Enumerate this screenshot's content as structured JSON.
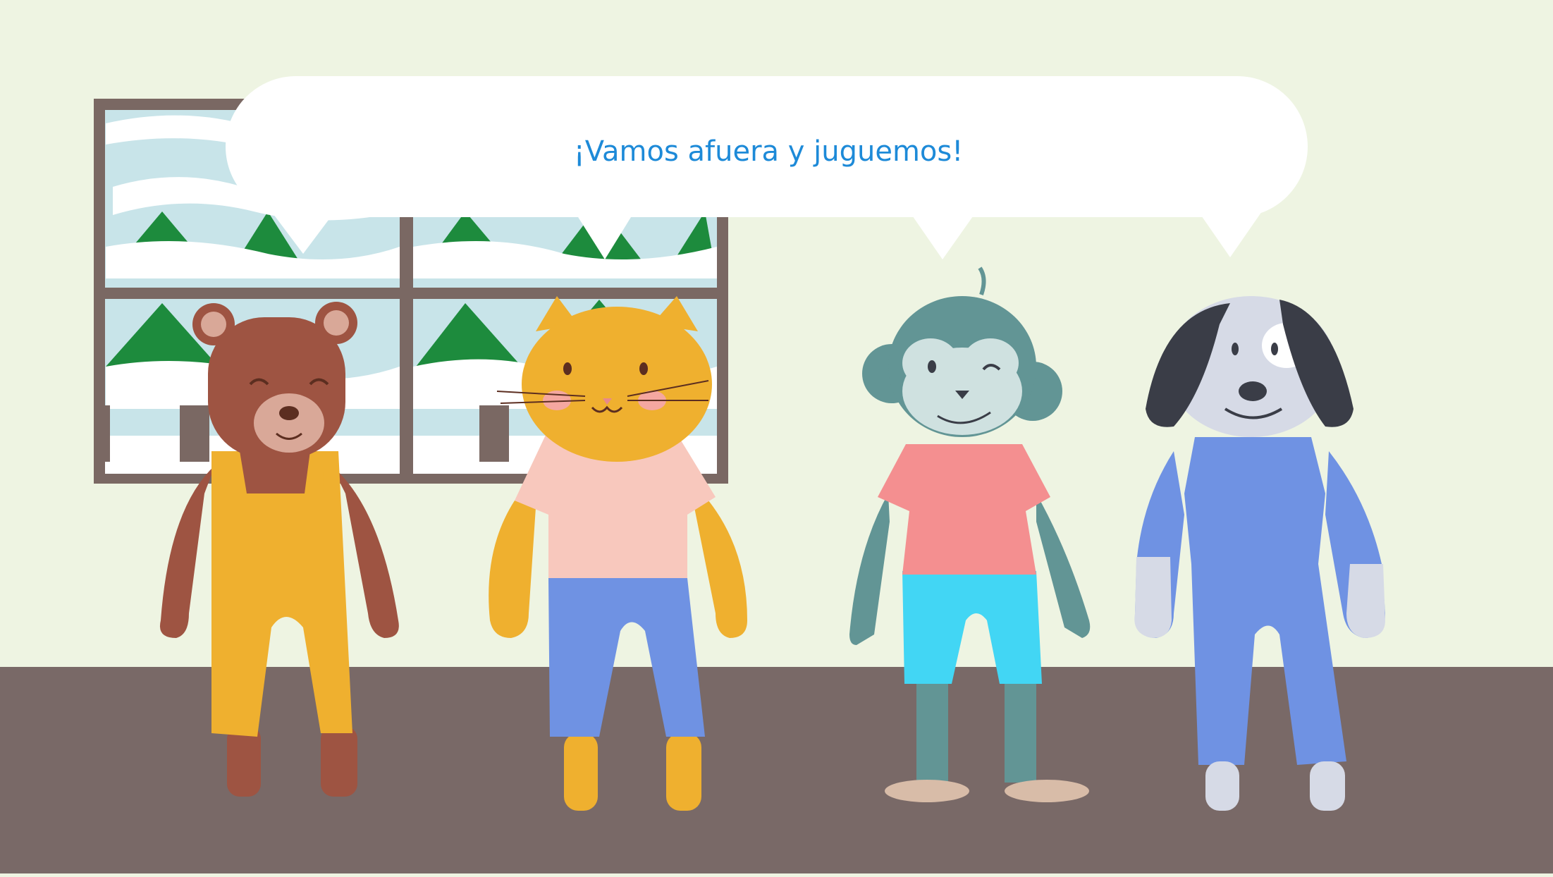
{
  "speech": {
    "text": "¡Vamos afuera y juguemos!"
  },
  "colors": {
    "wall": "#eef4e2",
    "floor": "#796967",
    "window_frame": "#7a6863",
    "tree_green": "#1d8b3d",
    "snow": "#ffffff",
    "bubble_text": "#1d8ad8",
    "bear_fur": "#9e5442",
    "cat_fur": "#efb02f",
    "monkey_fur": "#629595",
    "dog_fur": "#d6dae6",
    "dog_ear": "#3a3d47"
  },
  "characters": [
    {
      "name": "bear",
      "outfit": "yellow overalls",
      "expression": "smiling eyes closed"
    },
    {
      "name": "cat",
      "outfit": "pink shirt and blue pants",
      "expression": "smiling"
    },
    {
      "name": "monkey",
      "outfit": "pink shirt and cyan shorts",
      "expression": "winking"
    },
    {
      "name": "dog",
      "outfit": "blue pajamas",
      "expression": "smiling"
    }
  ]
}
